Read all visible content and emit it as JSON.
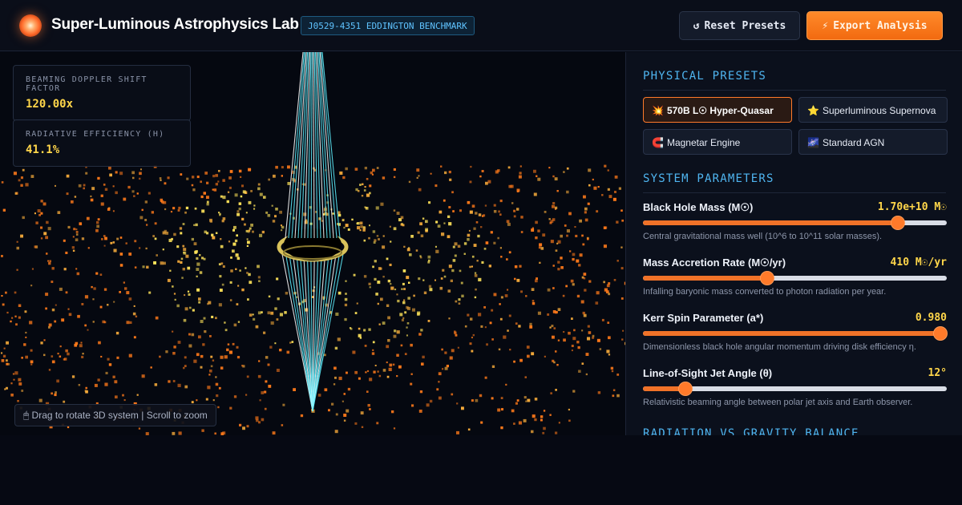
{
  "header": {
    "title": "Super-Luminous Astrophysics Lab",
    "badge": "J0529-4351 EDDINGTON BENCHMARK",
    "reset_icon": "↺",
    "reset_label": "Reset Presets",
    "export_icon": "⚡",
    "export_label": "Export Analysis"
  },
  "viewport": {
    "stats": [
      {
        "label": "BEAMING DOPPLER SHIFT FACTOR",
        "value": "120.00x"
      },
      {
        "label": "RADIATIVE EFFICIENCY (Η)",
        "value": "41.1%"
      }
    ],
    "hint_icon": "🖱",
    "hint": "Drag to rotate 3D system | Scroll to zoom",
    "colors": {
      "jet": "#5ff0ff",
      "disk_inner": "#ffe45a",
      "disk_outer": "#ff7a1a",
      "ring": "#d9c25a"
    }
  },
  "panel": {
    "presets_title": "PHYSICAL PRESETS",
    "presets": [
      {
        "icon": "💥",
        "label": "570B L☉ Hyper-Quasar",
        "active": true
      },
      {
        "icon": "⭐",
        "label": "Superluminous Supernova",
        "active": false
      },
      {
        "icon": "🧲",
        "label": "Magnetar Engine",
        "active": false
      },
      {
        "icon": "🌌",
        "label": "Standard AGN",
        "active": false
      }
    ],
    "params_title": "SYSTEM PARAMETERS",
    "params": [
      {
        "name": "Black Hole Mass (M☉)",
        "value": "1.70e+10 M☉",
        "fraction": 0.84,
        "desc": "Central gravitational mass well (10^6 to 10^11 solar masses)."
      },
      {
        "name": "Mass Accretion Rate (M☉/yr)",
        "value": "410 M☉/yr",
        "fraction": 0.41,
        "desc": "Infalling baryonic mass converted to photon radiation per year."
      },
      {
        "name": "Kerr Spin Parameter (a*)",
        "value": "0.980",
        "fraction": 0.98,
        "desc": "Dimensionless black hole angular momentum driving disk efficiency η."
      },
      {
        "name": "Line-of-Sight Jet Angle (θ)",
        "value": "12°",
        "fraction": 0.14,
        "desc": "Relativistic beaming angle between polar jet axis and Earth observer."
      }
    ],
    "balance_title": "RADIATION VS GRAVITY BALANCE",
    "accent": "#f07228"
  }
}
